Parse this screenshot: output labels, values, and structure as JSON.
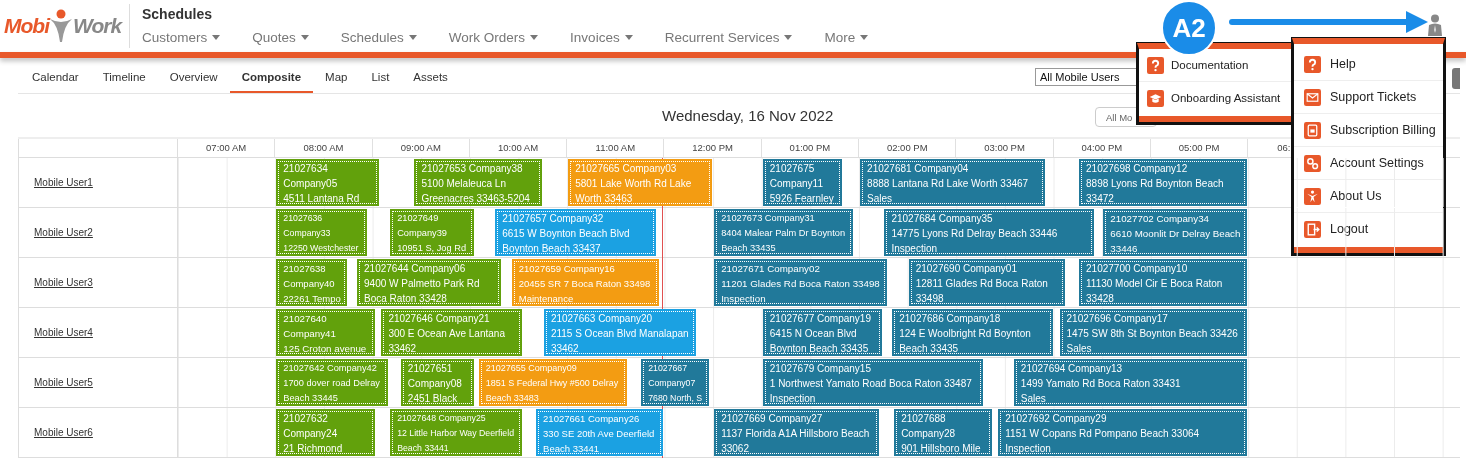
{
  "logo": {
    "first": "Mobi",
    "second": "Work"
  },
  "app_title": "Schedules",
  "nav": [
    "Customers",
    "Quotes",
    "Schedules",
    "Work Orders",
    "Invoices",
    "Recurrent Services",
    "More"
  ],
  "subtabs": [
    {
      "label": "Calendar",
      "selected": false
    },
    {
      "label": "Timeline",
      "selected": false
    },
    {
      "label": "Overview",
      "selected": false
    },
    {
      "label": "Composite",
      "selected": true
    },
    {
      "label": "Map",
      "selected": false
    },
    {
      "label": "List",
      "selected": false
    },
    {
      "label": "Assets",
      "selected": false
    }
  ],
  "user_filter": {
    "value": "All Mobile Users"
  },
  "date": "Wednesday, 16 Nov 2022",
  "second_filter": {
    "value": "All Mo"
  },
  "schedule": {
    "hours": [
      "07:00 AM",
      "08:00 AM",
      "09:00 AM",
      "10:00 AM",
      "11:00 AM",
      "12:00 PM",
      "01:00 PM",
      "02:00 PM",
      "03:00 PM",
      "04:00 PM",
      "05:00 PM",
      "06:"
    ],
    "rows": [
      {
        "user": "Mobile User1",
        "events": [
          {
            "lines": [
              "21027634",
              "Company05",
              "4511 Lantana Rd"
            ],
            "color": "#62a10c"
          },
          {
            "lines": [
              "21027653 Company38",
              "5100 Melaleuca Ln",
              "Greenacres 33463-5204"
            ],
            "color": "#62a10c"
          },
          {
            "lines": [
              "21027665 Company03",
              "5801 Lake Worth Rd Lake",
              "Worth 33463"
            ],
            "color": "#f39c12"
          },
          {
            "lines": [
              "21027675",
              "Company11",
              "5926 Fearnley"
            ],
            "color": "#21799a"
          },
          {
            "lines": [
              "21027681 Company04",
              "8888 Lantana Rd Lake Worth 33467",
              "Sales"
            ],
            "color": "#21799a"
          },
          {
            "lines": [
              "21027698 Company12",
              "8898 Lyons Rd Boynton Beach",
              "33472"
            ],
            "color": "#21799a"
          }
        ]
      },
      {
        "user": "Mobile User2",
        "events": [
          {
            "lines": [
              "21027636",
              "Company33",
              "12250 Westchester"
            ],
            "color": "#62a10c"
          },
          {
            "lines": [
              "21027649",
              "Company39",
              "10951 S, Jog Rd"
            ],
            "color": "#62a10c"
          },
          {
            "lines": [
              "21027657 Company32",
              "6615 W Boynton Beach Blvd",
              "Boynton Beach 33437"
            ],
            "color": "#1ba1e2"
          },
          {
            "lines": [
              "21027673 Company31",
              "8404 Malear Palm Dr Boynton",
              "Beach 33435"
            ],
            "color": "#21799a"
          },
          {
            "lines": [
              "21027684 Company35",
              "14775 Lyons Rd Delray Beach 33446",
              "Inspection"
            ],
            "color": "#21799a"
          },
          {
            "lines": [
              "21027702 Company34",
              "6610 Moonlit Dr Delray Beach",
              "33446"
            ],
            "color": "#21799a"
          }
        ]
      },
      {
        "user": "Mobile User3",
        "events": [
          {
            "lines": [
              "21027638",
              "Company40",
              "22261 Tempo"
            ],
            "color": "#62a10c"
          },
          {
            "lines": [
              "21027644 Company06",
              "9400 W Palmetto Park Rd",
              "Boca Raton 33428"
            ],
            "color": "#62a10c"
          },
          {
            "lines": [
              "21027659 Company16",
              "20455 SR 7 Boca Raton 33498",
              "Maintenance"
            ],
            "color": "#f39c12"
          },
          {
            "lines": [
              "21027671 Company02",
              "11201 Glades Rd Boca Raton 33498",
              "Inspection"
            ],
            "color": "#21799a"
          },
          {
            "lines": [
              "21027690 Company01",
              "12811 Glades Rd Boca Raton",
              "33498"
            ],
            "color": "#21799a"
          },
          {
            "lines": [
              "21027700 Company10",
              "11130 Model Cir E Boca Raton",
              "33428"
            ],
            "color": "#21799a"
          }
        ]
      },
      {
        "user": "Mobile User4",
        "events": [
          {
            "lines": [
              "21027640",
              "Company41",
              "125 Croton avenue"
            ],
            "color": "#62a10c"
          },
          {
            "lines": [
              "21027646 Company21",
              "300 E Ocean Ave Lantana",
              "33462"
            ],
            "color": "#62a10c"
          },
          {
            "lines": [
              "21027663 Company20",
              "2115 S Ocean Blvd Manalapan",
              "33462"
            ],
            "color": "#1ba1e2"
          },
          {
            "lines": [
              "21027677 Company19",
              "6415 N Ocean Blvd",
              "Boynton Beach 33435"
            ],
            "color": "#21799a"
          },
          {
            "lines": [
              "21027686 Company18",
              "124 E Woolbright Rd Boynton",
              "Beach 33435"
            ],
            "color": "#21799a"
          },
          {
            "lines": [
              "21027696 Company17",
              "1475 SW 8th St Boynton Beach 33426",
              "Sales"
            ],
            "color": "#21799a"
          }
        ]
      },
      {
        "user": "Mobile User5",
        "events": [
          {
            "lines": [
              "21027642 Company42",
              "1700 dover road Delray",
              "Beach 33445"
            ],
            "color": "#62a10c"
          },
          {
            "lines": [
              "21027651",
              "Company08",
              "2451 Black"
            ],
            "color": "#62a10c"
          },
          {
            "lines": [
              "21027655 Company09",
              "1851 S Federal Hwy #500 Delray",
              "Beach 33483"
            ],
            "color": "#f39c12"
          },
          {
            "lines": [
              "21027667",
              "Company07",
              "7680 North, S"
            ],
            "color": "#21799a"
          },
          {
            "lines": [
              "21027679 Company15",
              "1 Northwest Yamato Road Boca Raton 33487",
              "Inspection"
            ],
            "color": "#21799a"
          },
          {
            "lines": [
              "21027694 Company13",
              "1499 Yamato Rd Boca Raton 33431",
              "Sales"
            ],
            "color": "#21799a"
          }
        ]
      },
      {
        "user": "Mobile User6",
        "events": [
          {
            "lines": [
              "21027632",
              "Company24",
              "21 Richmond"
            ],
            "color": "#62a10c"
          },
          {
            "lines": [
              "21027648 Company25",
              "12 Little Harbor Way Deerfield",
              "Beach 33441"
            ],
            "color": "#62a10c"
          },
          {
            "lines": [
              "21027661 Company26",
              "330 SE 20th Ave Deerfield",
              "Beach 33441"
            ],
            "color": "#1ba1e2"
          },
          {
            "lines": [
              "21027669 Company27",
              "1137 Florida A1A Hillsboro Beach",
              "33062"
            ],
            "color": "#21799a"
          },
          {
            "lines": [
              "21027688",
              "Company28",
              "901 Hillsboro Mile"
            ],
            "color": "#21799a"
          },
          {
            "lines": [
              "21027692 Company29",
              "1151 W Copans Rd Pompano Beach 33064",
              "Inspection"
            ],
            "color": "#21799a"
          }
        ]
      }
    ]
  },
  "documentation_menu": {
    "items": [
      "Documentation",
      "Onboarding Assistant"
    ]
  },
  "account_menu": {
    "items": [
      "Help",
      "Support Tickets",
      "Subscription Billing",
      "Account Settings",
      "About Us",
      "Logout"
    ]
  },
  "annotation": {
    "label": "A2"
  }
}
